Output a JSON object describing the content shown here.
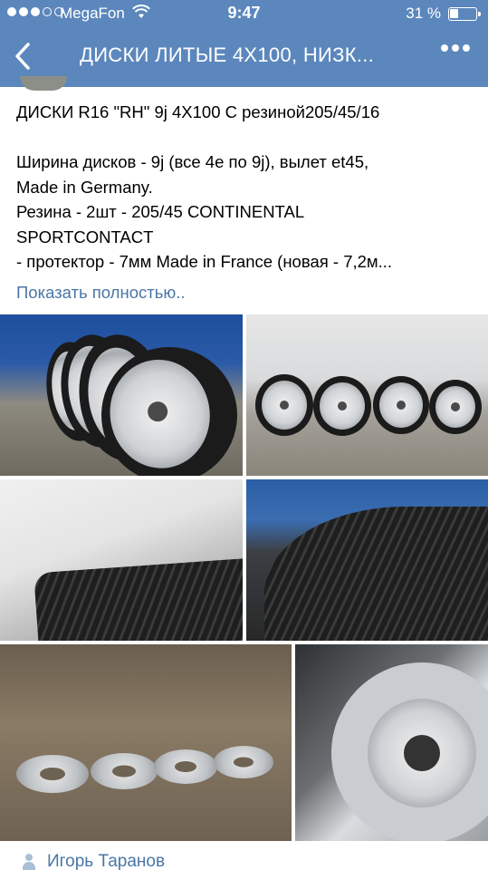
{
  "status_bar": {
    "carrier": "MegaFon",
    "time": "9:47",
    "battery": "31 %",
    "battery_level": 0.31,
    "signal_bars_filled": 3
  },
  "nav": {
    "title": "ДИСКИ ЛИТЫЕ 4X100,  НИЗК...",
    "back_icon": "chevron-left-icon",
    "more_icon": "more-dots-icon"
  },
  "post": {
    "lines": [
      "ДИСКИ R16 \"RH\" 9j 4X100 С резиной205/45/16",
      "",
      "Ширина дисков - 9j (все 4е по 9j), вылет et45,",
      "Made in Germany.",
      "Резина - 2шт - 205/45 CONTINENTAL",
      "SPORTCONTACT",
      "- протектор - 7мм Made in France (новая - 7,2м..."
    ],
    "show_more": "Показать полностью.."
  },
  "photos": [
    {
      "subject": "four-wheels-against-blue-wall"
    },
    {
      "subject": "four-wheels-front-row"
    },
    {
      "subject": "tire-tread-closeup"
    },
    {
      "subject": "tire-sidewall-closeup"
    },
    {
      "subject": "wheel-spacers-on-ground"
    },
    {
      "subject": "rim-center-closeup"
    }
  ],
  "author": {
    "name": "Игорь Таранов",
    "icon": "person-icon"
  },
  "colors": {
    "header_bg": "#5b87bd",
    "link": "#4a76a8",
    "text": "#000000"
  }
}
